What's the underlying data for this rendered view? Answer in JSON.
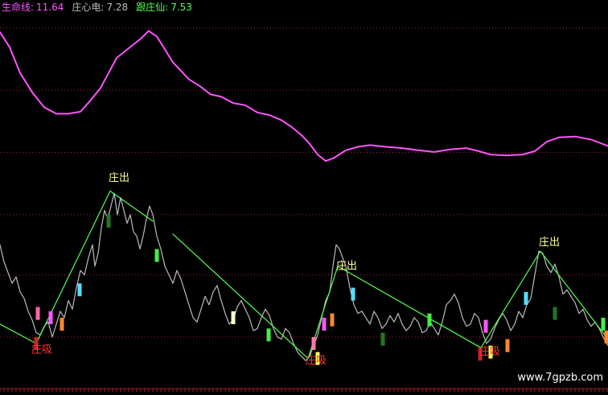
{
  "chart_data": {
    "type": "line",
    "legend": [
      {
        "label": "生命线:",
        "value": "11.64",
        "color": "#ff55ff"
      },
      {
        "label": "庄心电:",
        "value": "7.28",
        "color": "#bbbbbb"
      },
      {
        "label": "跟庄仙:",
        "value": "7.53",
        "color": "#55ff55"
      }
    ],
    "annotations": [
      {
        "text": "庄出",
        "x": 148,
        "y": 8.25,
        "color": "#ffff99"
      },
      {
        "text": "庄出",
        "x": 431,
        "y": 6.2,
        "color": "#ffff99"
      },
      {
        "text": "庄出",
        "x": 683,
        "y": 6.75,
        "color": "#ffff99"
      },
      {
        "text": "庄吸",
        "x": 52,
        "y": 4.25,
        "color": "#ff3333"
      },
      {
        "text": "庄吸",
        "x": 393,
        "y": 4.0,
        "color": "#ff3333"
      },
      {
        "text": "庄吸",
        "x": 609,
        "y": 4.2,
        "color": "#ff3333"
      }
    ],
    "watermark": "www.7gpzb.com",
    "grid": true,
    "series": [
      {
        "color": "#ff55ff",
        "points": [
          [
            0,
            11.65
          ],
          [
            12,
            11.3
          ],
          [
            25,
            10.7
          ],
          [
            40,
            10.25
          ],
          [
            55,
            9.9
          ],
          [
            70,
            9.75
          ],
          [
            85,
            9.75
          ],
          [
            100,
            9.8
          ],
          [
            112,
            10.05
          ],
          [
            125,
            10.35
          ],
          [
            135,
            10.7
          ],
          [
            145,
            11.05
          ],
          [
            155,
            11.2
          ],
          [
            165,
            11.35
          ],
          [
            175,
            11.5
          ],
          [
            185,
            11.68
          ],
          [
            195,
            11.55
          ],
          [
            205,
            11.25
          ],
          [
            215,
            10.95
          ],
          [
            225,
            10.75
          ],
          [
            235,
            10.55
          ],
          [
            248,
            10.4
          ],
          [
            262,
            10.2
          ],
          [
            275,
            10.15
          ],
          [
            290,
            10.0
          ],
          [
            305,
            9.95
          ],
          [
            320,
            9.78
          ],
          [
            335,
            9.72
          ],
          [
            350,
            9.6
          ],
          [
            362,
            9.45
          ],
          [
            375,
            9.25
          ],
          [
            385,
            9.05
          ],
          [
            395,
            8.8
          ],
          [
            405,
            8.65
          ],
          [
            415,
            8.72
          ],
          [
            430,
            8.9
          ],
          [
            445,
            8.98
          ],
          [
            460,
            9.02
          ],
          [
            480,
            8.98
          ],
          [
            500,
            8.95
          ],
          [
            520,
            8.9
          ],
          [
            540,
            8.86
          ],
          [
            560,
            8.92
          ],
          [
            580,
            8.95
          ],
          [
            595,
            8.88
          ],
          [
            610,
            8.8
          ],
          [
            630,
            8.78
          ],
          [
            650,
            8.8
          ],
          [
            665,
            8.88
          ],
          [
            680,
            9.1
          ],
          [
            695,
            9.2
          ],
          [
            715,
            9.22
          ],
          [
            735,
            9.15
          ],
          [
            756,
            9.0
          ]
        ]
      },
      {
        "color": "#bbbbbb",
        "points": [
          [
            0,
            6.7
          ],
          [
            5,
            6.3
          ],
          [
            10,
            6.05
          ],
          [
            15,
            5.8
          ],
          [
            20,
            5.95
          ],
          [
            25,
            5.6
          ],
          [
            30,
            5.45
          ],
          [
            35,
            5.15
          ],
          [
            40,
            4.95
          ],
          [
            45,
            4.65
          ],
          [
            50,
            4.6
          ],
          [
            55,
            4.8
          ],
          [
            60,
            4.9
          ],
          [
            65,
            4.55
          ],
          [
            70,
            4.85
          ],
          [
            75,
            5.15
          ],
          [
            80,
            5.0
          ],
          [
            85,
            5.4
          ],
          [
            90,
            5.2
          ],
          [
            95,
            5.7
          ],
          [
            100,
            6.1
          ],
          [
            105,
            6.0
          ],
          [
            110,
            6.4
          ],
          [
            115,
            6.7
          ],
          [
            118,
            6.2
          ],
          [
            122,
            6.5
          ],
          [
            126,
            7.1
          ],
          [
            130,
            7.5
          ],
          [
            134,
            7.3
          ],
          [
            138,
            7.6
          ],
          [
            142,
            7.9
          ],
          [
            146,
            7.4
          ],
          [
            150,
            7.8
          ],
          [
            154,
            7.5
          ],
          [
            158,
            7.2
          ],
          [
            162,
            7.4
          ],
          [
            166,
            7.0
          ],
          [
            170,
            6.9
          ],
          [
            174,
            6.6
          ],
          [
            178,
            6.9
          ],
          [
            182,
            7.3
          ],
          [
            186,
            7.6
          ],
          [
            190,
            7.4
          ],
          [
            195,
            6.9
          ],
          [
            200,
            6.6
          ],
          [
            205,
            6.2
          ],
          [
            210,
            6.0
          ],
          [
            215,
            5.8
          ],
          [
            220,
            6.1
          ],
          [
            225,
            5.9
          ],
          [
            230,
            5.6
          ],
          [
            235,
            5.3
          ],
          [
            240,
            5.0
          ],
          [
            245,
            4.9
          ],
          [
            250,
            5.2
          ],
          [
            255,
            5.5
          ],
          [
            260,
            5.3
          ],
          [
            265,
            5.6
          ],
          [
            270,
            5.75
          ],
          [
            275,
            5.4
          ],
          [
            280,
            5.1
          ],
          [
            285,
            4.85
          ],
          [
            290,
            4.95
          ],
          [
            295,
            5.25
          ],
          [
            300,
            5.4
          ],
          [
            305,
            5.2
          ],
          [
            310,
            5.0
          ],
          [
            315,
            4.7
          ],
          [
            320,
            4.75
          ],
          [
            325,
            5.0
          ],
          [
            330,
            5.2
          ],
          [
            335,
            5.05
          ],
          [
            340,
            4.75
          ],
          [
            345,
            4.55
          ],
          [
            350,
            4.5
          ],
          [
            355,
            4.75
          ],
          [
            360,
            4.65
          ],
          [
            365,
            4.4
          ],
          [
            370,
            4.2
          ],
          [
            375,
            4.1
          ],
          [
            380,
            4.0
          ],
          [
            385,
            4.1
          ],
          [
            390,
            4.35
          ],
          [
            395,
            4.6
          ],
          [
            400,
            5.0
          ],
          [
            405,
            5.4
          ],
          [
            410,
            5.6
          ],
          [
            414,
            6.2
          ],
          [
            418,
            6.7
          ],
          [
            422,
            6.6
          ],
          [
            426,
            6.4
          ],
          [
            430,
            6.2
          ],
          [
            435,
            5.7
          ],
          [
            440,
            5.3
          ],
          [
            445,
            5.1
          ],
          [
            450,
            5.15
          ],
          [
            455,
            5.0
          ],
          [
            460,
            4.85
          ],
          [
            465,
            5.15
          ],
          [
            470,
            5.0
          ],
          [
            475,
            4.75
          ],
          [
            480,
            4.85
          ],
          [
            485,
            5.05
          ],
          [
            490,
            4.9
          ],
          [
            495,
            5.1
          ],
          [
            500,
            4.85
          ],
          [
            505,
            4.7
          ],
          [
            510,
            4.8
          ],
          [
            515,
            5.0
          ],
          [
            520,
            4.9
          ],
          [
            525,
            4.65
          ],
          [
            530,
            4.7
          ],
          [
            535,
            4.9
          ],
          [
            540,
            4.75
          ],
          [
            545,
            4.6
          ],
          [
            550,
            4.9
          ],
          [
            555,
            5.3
          ],
          [
            560,
            5.4
          ],
          [
            565,
            5.55
          ],
          [
            570,
            5.35
          ],
          [
            575,
            5.0
          ],
          [
            580,
            4.8
          ],
          [
            585,
            4.85
          ],
          [
            590,
            5.1
          ],
          [
            595,
            5.0
          ],
          [
            600,
            4.65
          ],
          [
            605,
            4.4
          ],
          [
            610,
            4.5
          ],
          [
            615,
            4.75
          ],
          [
            620,
            4.95
          ],
          [
            625,
            5.1
          ],
          [
            630,
            4.95
          ],
          [
            635,
            4.7
          ],
          [
            640,
            4.85
          ],
          [
            645,
            5.15
          ],
          [
            650,
            5.0
          ],
          [
            655,
            5.3
          ],
          [
            660,
            5.45
          ],
          [
            665,
            6.0
          ],
          [
            670,
            6.55
          ],
          [
            675,
            6.5
          ],
          [
            680,
            6.2
          ],
          [
            685,
            6.05
          ],
          [
            690,
            6.25
          ],
          [
            695,
            5.95
          ],
          [
            700,
            5.55
          ],
          [
            705,
            5.65
          ],
          [
            710,
            5.5
          ],
          [
            715,
            5.35
          ],
          [
            720,
            5.1
          ],
          [
            725,
            5.2
          ],
          [
            730,
            4.95
          ],
          [
            735,
            4.8
          ],
          [
            740,
            4.9
          ],
          [
            745,
            4.75
          ],
          [
            750,
            4.55
          ],
          [
            756,
            4.35
          ]
        ]
      },
      {
        "color": "#55ff55",
        "points": [
          [
            0,
            4.85
          ],
          [
            45,
            4.4
          ],
          [
            137,
            7.95
          ],
          [
            190,
            7.25
          ]
        ]
      },
      {
        "color": "#55ff55",
        "points": [
          [
            215,
            6.95
          ],
          [
            383,
            4.05
          ],
          [
            420,
            6.2
          ],
          [
            598,
            4.3
          ],
          [
            672,
            6.55
          ],
          [
            756,
            4.5
          ]
        ]
      }
    ],
    "bars": [
      {
        "x": 45,
        "y": 4.4,
        "color": "#cc2222"
      },
      {
        "x": 47,
        "y": 5.1,
        "color": "#ff66aa"
      },
      {
        "x": 63,
        "y": 5.0,
        "color": "#ff55ff"
      },
      {
        "x": 77,
        "y": 4.85,
        "color": "#ff8833"
      },
      {
        "x": 99,
        "y": 5.65,
        "color": "#55ddff"
      },
      {
        "x": 135,
        "y": 7.25,
        "color": "#227722"
      },
      {
        "x": 195,
        "y": 6.45,
        "color": "#44ee44"
      },
      {
        "x": 290,
        "y": 5.0,
        "color": "#ffffcc"
      },
      {
        "x": 334,
        "y": 4.6,
        "color": "#44ee44"
      },
      {
        "x": 390,
        "y": 4.4,
        "color": "#ff77aa"
      },
      {
        "x": 395,
        "y": 4.05,
        "color": "#ffff55"
      },
      {
        "x": 403,
        "y": 4.85,
        "color": "#ff55ff"
      },
      {
        "x": 413,
        "y": 4.95,
        "color": "#ff8833"
      },
      {
        "x": 439,
        "y": 5.55,
        "color": "#55ddff"
      },
      {
        "x": 476,
        "y": 4.5,
        "color": "#227722"
      },
      {
        "x": 534,
        "y": 4.95,
        "color": "#44ee44"
      },
      {
        "x": 597,
        "y": 4.15,
        "color": "#cc2222"
      },
      {
        "x": 604,
        "y": 4.8,
        "color": "#ff55ff"
      },
      {
        "x": 610,
        "y": 4.2,
        "color": "#ffff55"
      },
      {
        "x": 631,
        "y": 4.35,
        "color": "#ff8833"
      },
      {
        "x": 654,
        "y": 5.45,
        "color": "#55ddff"
      },
      {
        "x": 690,
        "y": 5.1,
        "color": "#227722"
      },
      {
        "x": 750,
        "y": 4.85,
        "color": "#44ee44"
      },
      {
        "x": 754,
        "y": 4.55,
        "color": "#ff8833"
      }
    ],
    "xlim": [
      0,
      756
    ],
    "ylim": [
      3.35,
      12.4
    ],
    "gridlines": [
      11.75,
      10.3,
      8.85,
      7.4,
      6.0,
      4.55
    ],
    "colors": {
      "background": "#000000",
      "grid": "#aa2222",
      "axis": "#aa2222"
    }
  }
}
